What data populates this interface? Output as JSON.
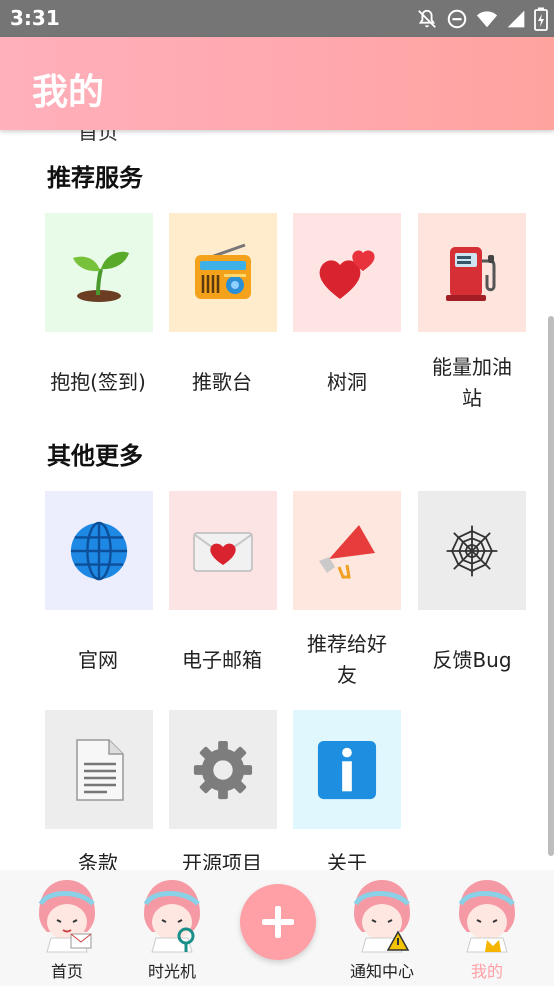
{
  "status_bar": {
    "time": "3:31"
  },
  "header": {
    "title": "我的"
  },
  "content": {
    "peek_text": "首页",
    "recommended": {
      "title": "推荐服务",
      "items": [
        {
          "label": "抱抱(签到)",
          "icon": "seedling-icon",
          "bg": "#e8fbe8"
        },
        {
          "label": "推歌台",
          "icon": "radio-icon",
          "bg": "#ffeccc"
        },
        {
          "label": "树洞",
          "icon": "two-hearts-icon",
          "bg": "#ffe4e4"
        },
        {
          "label": "能量加油站",
          "icon": "fuel-pump-icon",
          "bg": "#fde4dc"
        }
      ]
    },
    "more": {
      "title": "其他更多",
      "items": [
        {
          "label": "官网",
          "icon": "globe-icon",
          "bg": "#eceefe"
        },
        {
          "label": "电子邮箱",
          "icon": "love-letter-icon",
          "bg": "#fde4e4"
        },
        {
          "label": "推荐给好友",
          "icon": "megaphone-icon",
          "bg": "#fde7df"
        },
        {
          "label": "反馈Bug",
          "icon": "spider-web-icon",
          "bg": "#ececec"
        },
        {
          "label": "条款",
          "icon": "document-icon",
          "bg": "#ededed"
        },
        {
          "label": "开源项目",
          "icon": "gear-icon",
          "bg": "#ededed"
        },
        {
          "label": "关于",
          "icon": "info-icon",
          "bg": "#e0f7fd"
        }
      ]
    }
  },
  "bottom_nav": {
    "items": [
      {
        "label": "首页",
        "icon": "anime-avatar-letter-icon"
      },
      {
        "label": "时光机",
        "icon": "anime-avatar-search-icon"
      },
      {
        "label": "通知中心",
        "icon": "anime-avatar-warning-icon"
      },
      {
        "label": "我的",
        "icon": "anime-avatar-crown-icon"
      }
    ],
    "active_index": 3,
    "fab_icon": "plus-icon"
  },
  "colors": {
    "accent": "#ffa0a6",
    "active_nav": "#ff9fa6",
    "status_bar": "#757575"
  }
}
